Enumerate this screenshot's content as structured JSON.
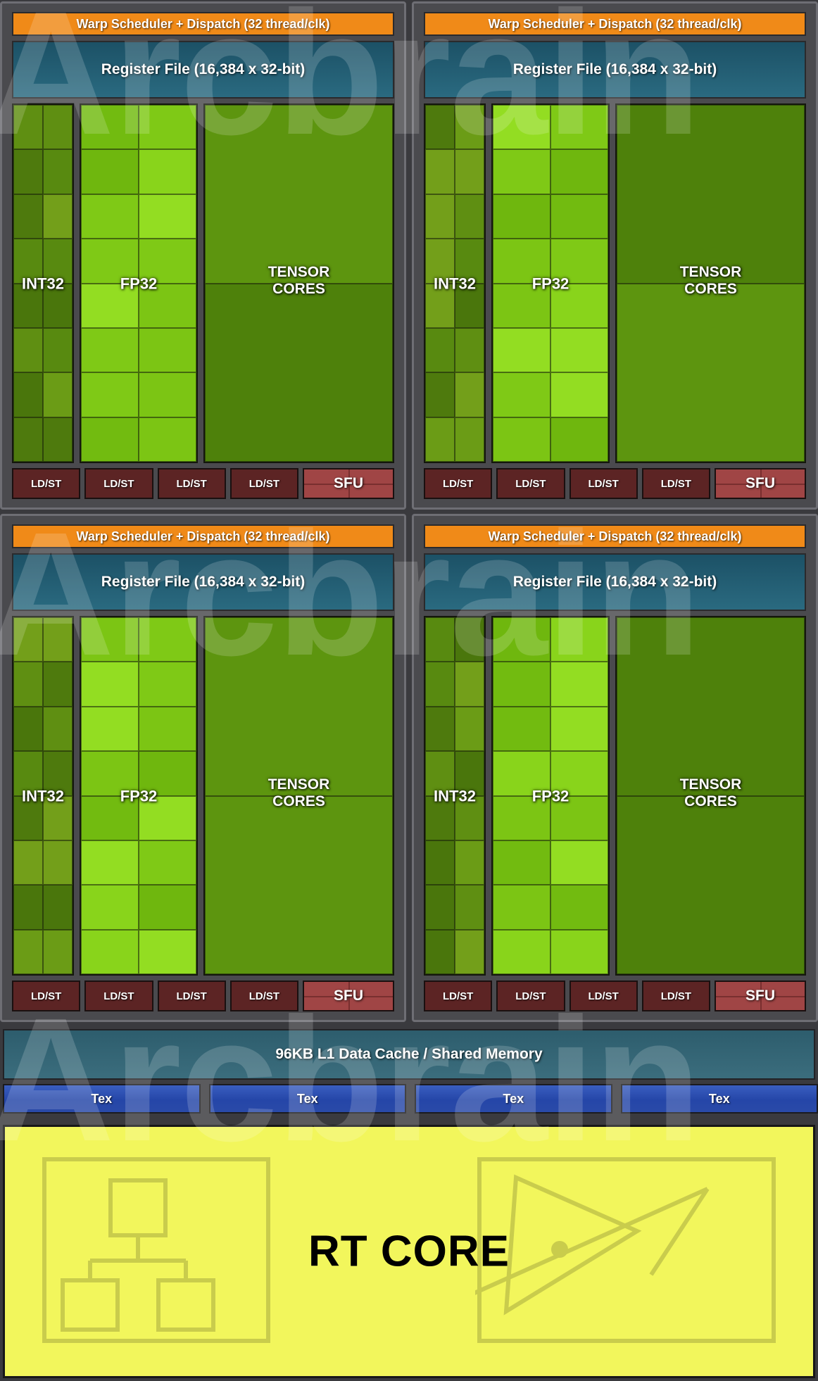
{
  "diagram": {
    "title": "NVIDIA Turing SM Architecture Block Diagram",
    "watermark_text": "Arcbrain",
    "colors": {
      "background": "#3a3a3e",
      "sm_fill": "#4a4a4e",
      "sm_border": "#6e6e74",
      "warp_scheduler": "#f08a18",
      "register_file": "#1f5a6e",
      "int32": "#5f8a14",
      "fp32": "#7dc614",
      "tensor_cores": "#52890f",
      "ldst": "#5c2424",
      "sfu": "#a04545",
      "l1_cache": "#2d5d6d",
      "tex": "#2a4aa8",
      "rt_core": "#f2f65c",
      "rt_core_line": "#c9cc4c"
    }
  },
  "sm_partitions": [
    {
      "id": "sm-partition-0",
      "warp_scheduler": "Warp Scheduler + Dispatch (32 thread/clk)",
      "register_file": "Register File (16,384 x 32-bit)",
      "units": [
        {
          "name": "int32",
          "label": "INT32",
          "columns": 2,
          "rows": 8
        },
        {
          "name": "fp32",
          "label": "FP32",
          "columns": 2,
          "rows": 8
        },
        {
          "name": "tensor",
          "label": "TENSOR CORES",
          "columns": 1,
          "rows": 2
        }
      ],
      "ldst_units": [
        "LD/ST",
        "LD/ST",
        "LD/ST",
        "LD/ST"
      ],
      "sfu": "SFU"
    },
    {
      "id": "sm-partition-1",
      "warp_scheduler": "Warp Scheduler + Dispatch (32 thread/clk)",
      "register_file": "Register File (16,384 x 32-bit)",
      "units": [
        {
          "name": "int32",
          "label": "INT32",
          "columns": 2,
          "rows": 8
        },
        {
          "name": "fp32",
          "label": "FP32",
          "columns": 2,
          "rows": 8
        },
        {
          "name": "tensor",
          "label": "TENSOR CORES",
          "columns": 1,
          "rows": 2
        }
      ],
      "ldst_units": [
        "LD/ST",
        "LD/ST",
        "LD/ST",
        "LD/ST"
      ],
      "sfu": "SFU"
    },
    {
      "id": "sm-partition-2",
      "warp_scheduler": "Warp Scheduler + Dispatch (32 thread/clk)",
      "register_file": "Register File (16,384 x 32-bit)",
      "units": [
        {
          "name": "int32",
          "label": "INT32",
          "columns": 2,
          "rows": 8
        },
        {
          "name": "fp32",
          "label": "FP32",
          "columns": 2,
          "rows": 8
        },
        {
          "name": "tensor",
          "label": "TENSOR CORES",
          "columns": 1,
          "rows": 2
        }
      ],
      "ldst_units": [
        "LD/ST",
        "LD/ST",
        "LD/ST",
        "LD/ST"
      ],
      "sfu": "SFU"
    },
    {
      "id": "sm-partition-3",
      "warp_scheduler": "Warp Scheduler + Dispatch (32 thread/clk)",
      "register_file": "Register File (16,384 x 32-bit)",
      "units": [
        {
          "name": "int32",
          "label": "INT32",
          "columns": 2,
          "rows": 8
        },
        {
          "name": "fp32",
          "label": "FP32",
          "columns": 2,
          "rows": 8
        },
        {
          "name": "tensor",
          "label": "TENSOR CORES",
          "columns": 1,
          "rows": 2
        }
      ],
      "ldst_units": [
        "LD/ST",
        "LD/ST",
        "LD/ST",
        "LD/ST"
      ],
      "sfu": "SFU"
    }
  ],
  "l1_cache": {
    "label": "96KB L1 Data Cache / Shared Memory"
  },
  "tex_units": [
    {
      "label": "Tex"
    },
    {
      "label": "Tex"
    },
    {
      "label": "Tex"
    },
    {
      "label": "Tex"
    }
  ],
  "rt_core": {
    "label": "RT CORE",
    "left_diagram": "bvh-tree-icon",
    "right_diagram": "ray-triangle-intersection-icon"
  }
}
